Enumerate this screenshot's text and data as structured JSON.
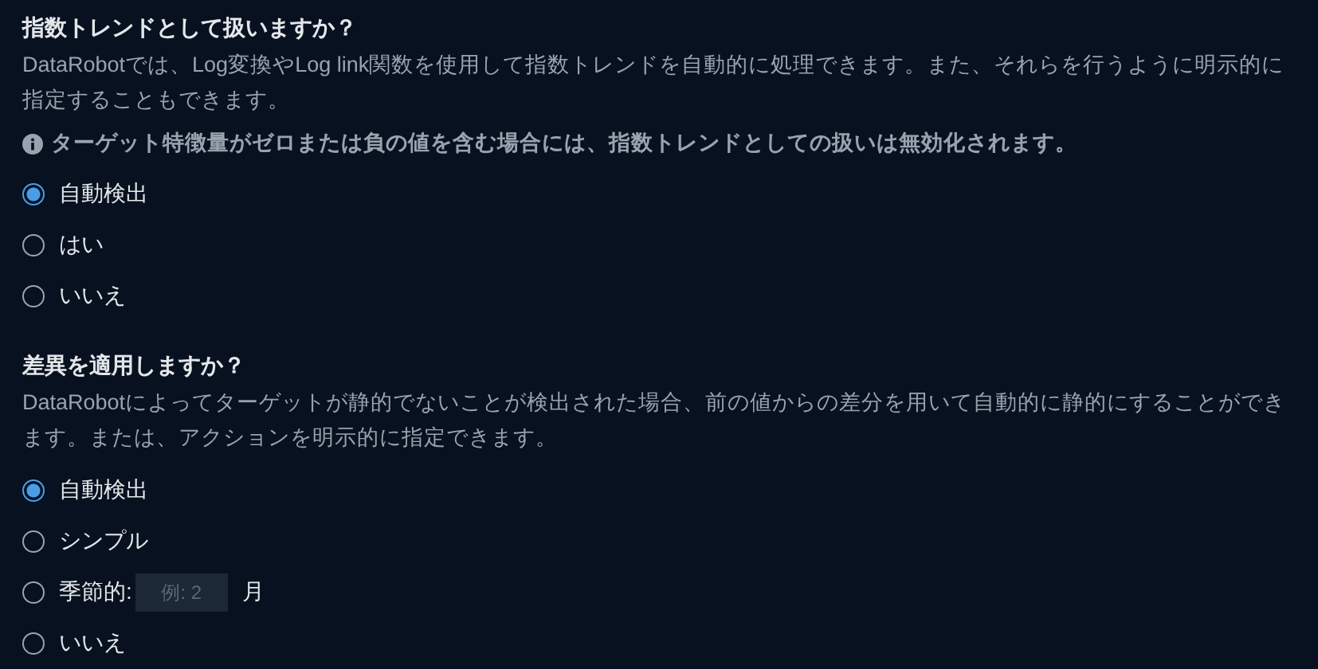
{
  "sections": [
    {
      "title": "指数トレンドとして扱いますか？",
      "description": "DataRobotでは、Log変換やLog link関数を使用して指数トレンドを自動的に処理できます。また、それらを行うように明示的に指定することもできます。",
      "note": "ターゲット特徴量がゼロまたは負の値を含む場合には、指数トレンドとしての扱いは無効化されます。",
      "options": [
        {
          "kind": "plain",
          "label": "自動検出",
          "selected": true
        },
        {
          "kind": "plain",
          "label": "はい",
          "selected": false
        },
        {
          "kind": "plain",
          "label": "いいえ",
          "selected": false
        }
      ]
    },
    {
      "title": "差異を適用しますか？",
      "description": "DataRobotによってターゲットが静的でないことが検出された場合、前の値からの差分を用いて自動的に静的にすることができます。または、アクションを明示的に指定できます。",
      "options": [
        {
          "kind": "plain",
          "label": "自動検出",
          "selected": true
        },
        {
          "kind": "plain",
          "label": "シンプル",
          "selected": false
        },
        {
          "kind": "input",
          "label": "季節的:",
          "placeholder": "例: 2",
          "suffix": "月",
          "selected": false
        },
        {
          "kind": "plain",
          "label": "いいえ",
          "selected": false
        }
      ]
    }
  ]
}
